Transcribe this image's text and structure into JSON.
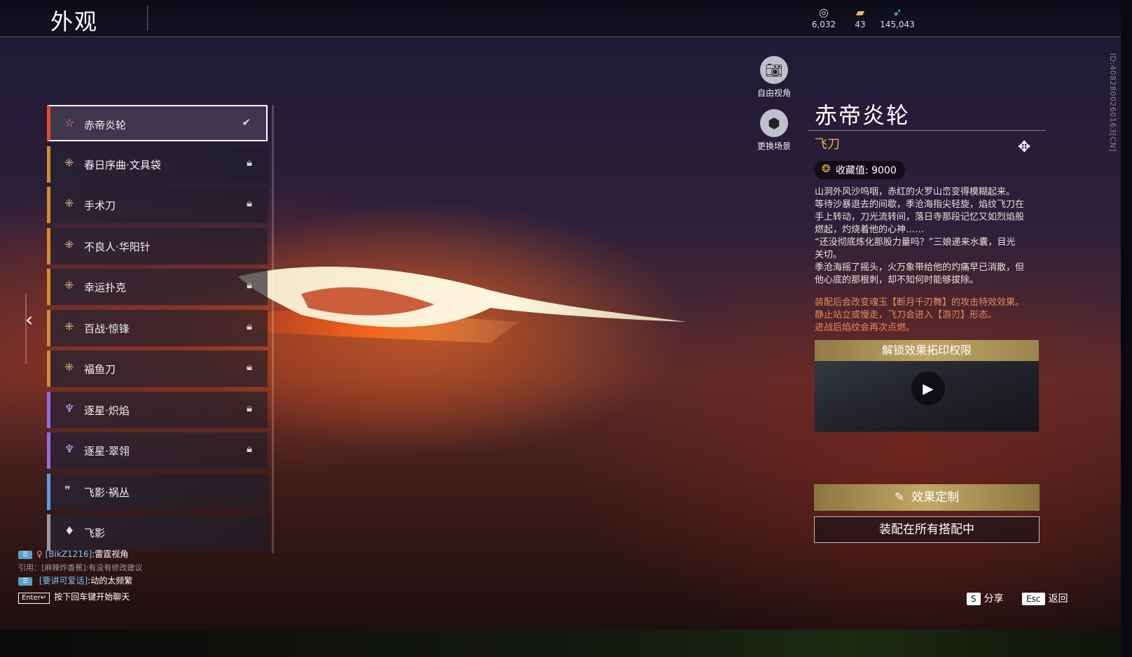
{
  "header": {
    "title": "外观",
    "currencies": [
      {
        "icon": "jade-coin-icon",
        "value": "6,032"
      },
      {
        "icon": "ticket-icon",
        "value": "43"
      },
      {
        "icon": "feather-icon",
        "value": "145,043"
      }
    ],
    "id_text": "ID:4082800260163[CN]"
  },
  "list": {
    "items": [
      {
        "label": "赤帝炎轮",
        "rarity": "red",
        "state": "equipped"
      },
      {
        "label": "春日序曲·文具袋",
        "rarity": "gold",
        "state": "locked"
      },
      {
        "label": "手术刀",
        "rarity": "gold",
        "state": "locked"
      },
      {
        "label": "不良人·华阳针",
        "rarity": "gold",
        "state": "none"
      },
      {
        "label": "幸运扑克",
        "rarity": "gold",
        "state": "locked"
      },
      {
        "label": "百战·惊锋",
        "rarity": "gold",
        "state": "locked"
      },
      {
        "label": "福鱼刀",
        "rarity": "gold",
        "state": "locked"
      },
      {
        "label": "逐星·炽焰",
        "rarity": "purple",
        "state": "locked"
      },
      {
        "label": "逐星·翠翎",
        "rarity": "purple",
        "state": "locked"
      },
      {
        "label": "飞影·祸丛",
        "rarity": "blue",
        "state": "none"
      },
      {
        "label": "飞影",
        "rarity": "gray",
        "state": "none"
      }
    ]
  },
  "side_buttons": {
    "free_camera": "自由视角",
    "change_scene": "更换场景"
  },
  "detail": {
    "name": "赤帝炎轮",
    "type": "飞刀",
    "collect_label": "收藏值:",
    "collect_value": "9000",
    "description": [
      "山洞外风沙呜咽，赤红的火罗山峦变得模糊起来。",
      "等待沙暴退去的间歇，季沧海指尖轻旋，焰纹飞刀在",
      "手上转动，刀光流转间，落日寺那段记忆又如烈焰般",
      "燃起，灼烧着他的心神……",
      "“还没彻底炼化那股力量吗？”三娘递来水囊，目光",
      "关切。",
      "季沧海摇了摇头，火万象带给他的灼痛早已消散，但",
      "他心底的那根刺，却不知何时能够拔除。"
    ],
    "effect": [
      "装配后会改变魂玉【断月千刃舞】的攻击特效效果。",
      "静止站立或慢走，飞刀会进入【游刃】形态。",
      "进战后焰纹会再次点燃。"
    ],
    "preview_title": "解锁效果拓印权限",
    "customize_label": "效果定制",
    "equip_all_label": "装配在所有搭配中"
  },
  "chat": {
    "line1_user": "[BikZ1216]",
    "line1_text": ":雷霆视角",
    "line2_quote": "引用：[麻辣炸香蕉]:有没有修改建议",
    "line3_user": "[要讲可爱话]",
    "line3_text": ":动的太频繁",
    "enter_key": "Enter↵",
    "enter_hint": "按下回车键开始聊天"
  },
  "hotkeys": [
    {
      "key": "S",
      "label": "分享"
    },
    {
      "key": "Esc",
      "label": "返回"
    }
  ],
  "colors": {
    "accent_gold": "#c2a866",
    "rarity_red": "#e54a2e",
    "rarity_gold": "#d98a2b",
    "rarity_purple": "#9a6be0",
    "rarity_blue": "#5b9be6"
  }
}
